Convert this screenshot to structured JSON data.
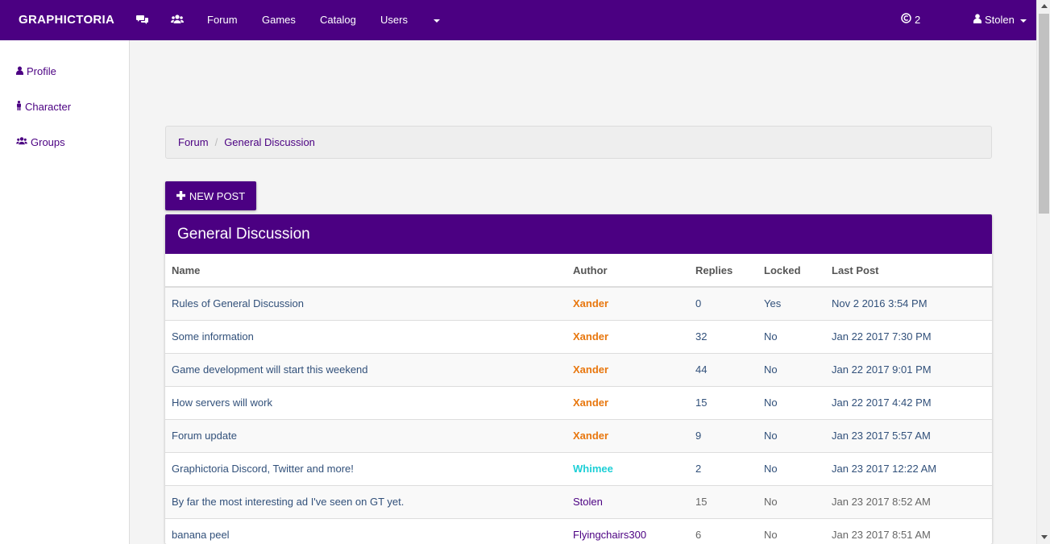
{
  "navbar": {
    "brand": "GRAPHICTORIA",
    "links": [
      "Forum",
      "Games",
      "Catalog",
      "Users"
    ],
    "currency_amount": "2",
    "username": "Stolen"
  },
  "sidebar": {
    "items": [
      {
        "label": "Profile",
        "icon": "user-icon"
      },
      {
        "label": "Character",
        "icon": "male-icon"
      },
      {
        "label": "Groups",
        "icon": "users-icon"
      }
    ]
  },
  "breadcrumb": {
    "items": [
      "Forum",
      "General Discussion"
    ]
  },
  "new_post_label": "NEW POST",
  "panel": {
    "title": "General Discussion",
    "columns": [
      "Name",
      "Author",
      "Replies",
      "Locked",
      "Last Post"
    ],
    "rows": [
      {
        "name": "Rules of General Discussion",
        "author": "Xander",
        "author_color": "#e8770e",
        "author_bold": true,
        "replies": "0",
        "locked": "Yes",
        "last_post": "Nov 2 2016 3:54 PM",
        "pinned": true
      },
      {
        "name": "Some information",
        "author": "Xander",
        "author_color": "#e8770e",
        "author_bold": true,
        "replies": "32",
        "locked": "No",
        "last_post": "Jan 22 2017 7:30 PM",
        "pinned": true
      },
      {
        "name": "Game development will start this weekend",
        "author": "Xander",
        "author_color": "#e8770e",
        "author_bold": true,
        "replies": "44",
        "locked": "No",
        "last_post": "Jan 22 2017 9:01 PM",
        "pinned": true
      },
      {
        "name": "How servers will work",
        "author": "Xander",
        "author_color": "#e8770e",
        "author_bold": true,
        "replies": "15",
        "locked": "No",
        "last_post": "Jan 22 2017 4:42 PM",
        "pinned": true
      },
      {
        "name": "Forum update",
        "author": "Xander",
        "author_color": "#e8770e",
        "author_bold": true,
        "replies": "9",
        "locked": "No",
        "last_post": "Jan 23 2017 5:57 AM",
        "pinned": true
      },
      {
        "name": "Graphictoria Discord, Twitter and more!",
        "author": "Whimee",
        "author_color": "#1ecfd6",
        "author_bold": true,
        "replies": "2",
        "locked": "No",
        "last_post": "Jan 23 2017 12:22 AM",
        "pinned": true
      },
      {
        "name": "By far the most interesting ad I've seen on GT yet.",
        "author": "Stolen",
        "author_color": "#4b0082",
        "author_bold": false,
        "replies": "15",
        "locked": "No",
        "last_post": "Jan 23 2017 8:52 AM",
        "pinned": false
      },
      {
        "name": "banana peel",
        "author": "Flyingchairs300",
        "author_color": "#4b0082",
        "author_bold": false,
        "replies": "6",
        "locked": "No",
        "last_post": "Jan 23 2017 8:51 AM",
        "pinned": false
      }
    ]
  },
  "colors": {
    "brand_purple": "#4b0082",
    "staff_orange": "#e8770e",
    "moderator_cyan": "#1ecfd6"
  }
}
